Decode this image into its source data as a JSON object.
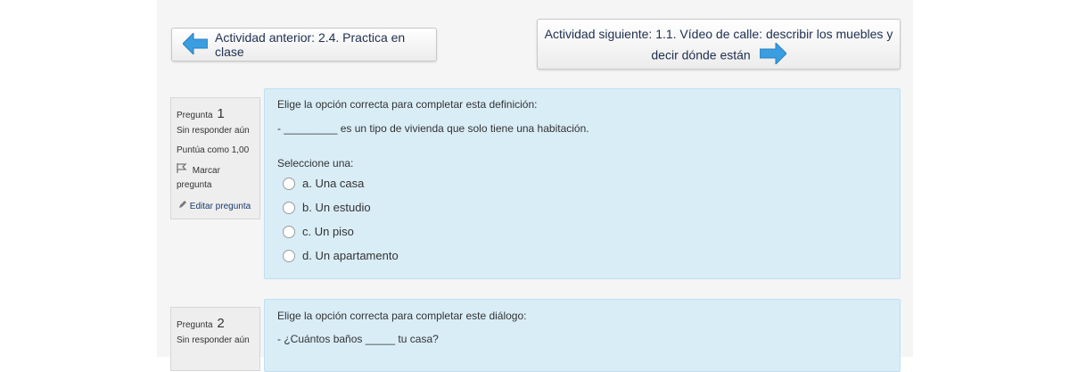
{
  "navigation": {
    "prev_label": "Actividad anterior: 2.4. Practica en clase",
    "next_line1": "Actividad siguiente: 1.1. Vídeo de calle: describir los muebles y",
    "next_line2": "decir dónde están"
  },
  "questions": [
    {
      "info": {
        "pregunta_label": "Pregunta",
        "number": "1",
        "state": "Sin responder aún",
        "marks": "Puntúa como 1,00",
        "flag_line1": "Marcar",
        "flag_line2": "pregunta",
        "edit_label": "Editar pregunta"
      },
      "prompt": "Elige la opción correcta para completar esta definición:",
      "text": "- _________ es un tipo de vivienda que solo tiene una habitación.",
      "select_label": "Seleccione una:",
      "options": [
        "a. Una casa",
        "b. Un estudio",
        "c. Un piso",
        "d. Un apartamento"
      ]
    },
    {
      "info": {
        "pregunta_label": "Pregunta",
        "number": "2",
        "state": "Sin responder aún"
      },
      "prompt": "Elige la opción correcta para completar este diálogo:",
      "text": "- ¿Cuántos baños _____ tu casa?"
    }
  ],
  "colors": {
    "question_bg": "#d9edf7",
    "link": "#1a3a6e",
    "arrow": "#3a9ee0"
  },
  "icons": [
    "arrow-left-icon",
    "arrow-right-icon",
    "flag-icon",
    "pencil-icon"
  ]
}
